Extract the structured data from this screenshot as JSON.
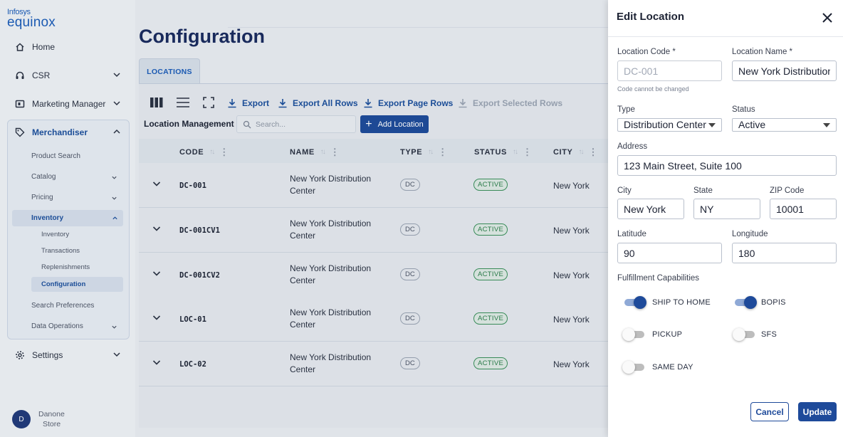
{
  "logo": {
    "line1": "Infosys",
    "line2": "equinox"
  },
  "sidebar": {
    "home": "Home",
    "csr": "CSR",
    "marketing": "Marketing Manager",
    "merchandiser": "Merchandiser",
    "sub": {
      "product_search": "Product Search",
      "catalog": "Catalog",
      "pricing": "Pricing",
      "inventory": "Inventory",
      "inv_inventory": "Inventory",
      "inv_transactions": "Transactions",
      "inv_replenishments": "Replenishments",
      "inv_configuration": "Configuration",
      "search_preferences": "Search Preferences",
      "data_operations": "Data Operations"
    },
    "settings": "Settings",
    "user": {
      "initial": "D",
      "name": "Danone",
      "store": "Store"
    }
  },
  "page": {
    "title": "Configuration",
    "tab": "LOCATIONS"
  },
  "toolbar": {
    "export": "Export",
    "export_all": "Export All Rows",
    "export_page": "Export Page Rows",
    "export_selected": "Export Selected Rows",
    "section_title": "Location Management",
    "search_placeholder": "Search...",
    "add_location": "Add Location"
  },
  "table": {
    "columns": [
      "CODE",
      "NAME",
      "TYPE",
      "STATUS",
      "CITY"
    ],
    "rows": [
      {
        "code": "DC-001",
        "name": "New York Distribution Center",
        "type": "DC",
        "status": "ACTIVE",
        "city": "New York"
      },
      {
        "code": "DC-001CV1",
        "name": "New York Distribution Center",
        "type": "DC",
        "status": "ACTIVE",
        "city": "New York"
      },
      {
        "code": "DC-001CV2",
        "name": "New York Distribution Center",
        "type": "DC",
        "status": "ACTIVE",
        "city": "New York"
      },
      {
        "code": "LOC-01",
        "name": "New York Distribution Center",
        "type": "DC",
        "status": "ACTIVE",
        "city": "New York"
      },
      {
        "code": "LOC-02",
        "name": "New York Distribution Center",
        "type": "DC",
        "status": "ACTIVE",
        "city": "New York"
      }
    ]
  },
  "drawer": {
    "title": "Edit Location",
    "location_code": {
      "label": "Location Code *",
      "value": "DC-001",
      "hint": "Code cannot be changed"
    },
    "location_name": {
      "label": "Location Name *",
      "value": "New York Distribution"
    },
    "type": {
      "label": "Type",
      "value": "Distribution Center"
    },
    "status": {
      "label": "Status",
      "value": "Active"
    },
    "address": {
      "label": "Address",
      "value": "123 Main Street, Suite 100"
    },
    "city": {
      "label": "City",
      "value": "New York"
    },
    "state": {
      "label": "State",
      "value": "NY"
    },
    "zip": {
      "label": "ZIP Code",
      "value": "10001"
    },
    "latitude": {
      "label": "Latitude",
      "value": "90"
    },
    "longitude": {
      "label": "Longitude",
      "value": "180"
    },
    "capabilities": {
      "label": "Fulfillment Capabilities",
      "ship_to_home": {
        "label": "SHIP TO HOME",
        "on": true
      },
      "bopis": {
        "label": "BOPIS",
        "on": true
      },
      "pickup": {
        "label": "PICKUP",
        "on": false
      },
      "sfs": {
        "label": "SFS",
        "on": false
      },
      "same_day": {
        "label": "SAME DAY",
        "on": false
      }
    },
    "cancel": "Cancel",
    "update": "Update"
  },
  "colors": {
    "brand": "#1e4a9a",
    "active_status": "#2b7d4a",
    "title": "#1a2a5e"
  }
}
